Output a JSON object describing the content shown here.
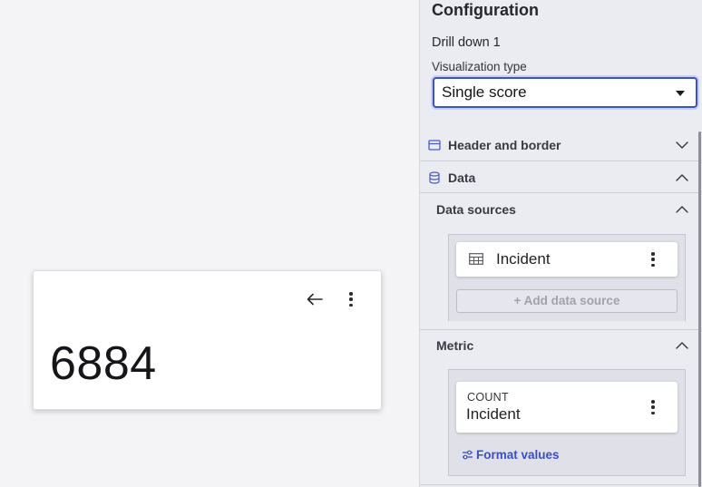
{
  "canvas": {
    "score_value": "6884",
    "back_icon": "arrow-left-icon",
    "menu_icon": "kebab-menu-icon"
  },
  "panel": {
    "title": "Configuration",
    "drill_label": "Drill down 1",
    "visualization": {
      "label": "Visualization type",
      "selected": "Single score"
    },
    "sections": {
      "header_border": {
        "label": "Header and border",
        "expanded": false,
        "icon": "header-border-icon"
      },
      "data": {
        "label": "Data",
        "expanded": true,
        "icon": "database-icon"
      },
      "data_sources": {
        "label": "Data sources",
        "expanded": true,
        "items": [
          {
            "name": "Incident",
            "icon": "table-icon"
          }
        ],
        "add_label": "+ Add data source"
      },
      "metric": {
        "label": "Metric",
        "expanded": true,
        "aggregation": "COUNT",
        "table": "Incident",
        "format_label": "Format values"
      }
    },
    "colors": {
      "accent": "#3c52c7",
      "panel_bg": "#ebebf2",
      "canvas_bg": "#f4f4f6"
    }
  }
}
